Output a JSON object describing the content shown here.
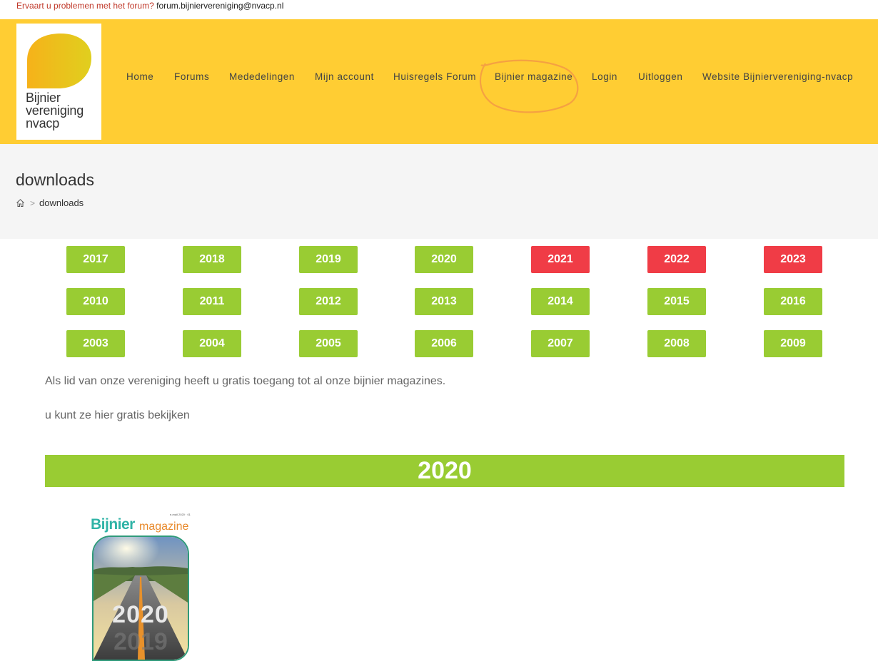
{
  "topbar": {
    "question": "Ervaart u problemen met het forum?",
    "email": "forum.bijniervereniging@nvacp.nl"
  },
  "logo": {
    "line1": "Bijnier",
    "line2": "vereniging",
    "line3": "nvacp"
  },
  "nav": [
    "Home",
    "Forums",
    "Mededelingen",
    "Mijn account",
    "Huisregels Forum",
    "Bijnier magazine",
    "Login",
    "Uitloggen",
    "Website Bijniervereniging-nvacp"
  ],
  "page": {
    "title": "downloads",
    "breadcrumb_current": "downloads"
  },
  "years": {
    "row1": [
      "2017",
      "2018",
      "2019",
      "2020",
      "2021",
      "2022",
      "2023"
    ],
    "row2": [
      "2010",
      "2011",
      "2012",
      "2013",
      "2014",
      "2015",
      "2016"
    ],
    "row3": [
      "2003",
      "2004",
      "2005",
      "2006",
      "2007",
      "2008",
      "2009"
    ]
  },
  "colors": {
    "header": "#ffcd33",
    "green": "#99cc33",
    "red": "#f03c46",
    "annotation": "#f5a142"
  },
  "text": {
    "p1": "Als lid van onze vereniging heeft u gratis toegang tot al onze bijnier magazines.",
    "p2": "u kunt ze hier gratis bekijken"
  },
  "section": {
    "year": "2020"
  },
  "magazine": {
    "brand": "Bijnier",
    "brand_suffix": "magazine",
    "issue": "e-mail 2020 · 01",
    "cover_text": "2020",
    "cover_text_faded": "2019"
  }
}
